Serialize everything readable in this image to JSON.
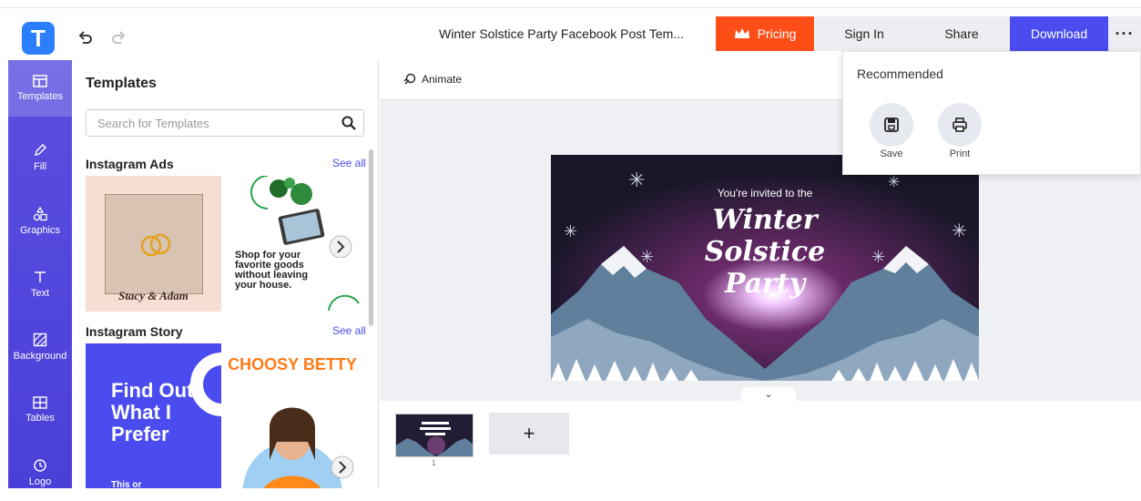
{
  "header": {
    "logo_letter": "T",
    "undo_icon": "undo-icon",
    "redo_icon": "redo-icon",
    "document_title": "Winter Solstice Party Facebook Post Tem...",
    "pricing_label": "Pricing",
    "pricing_icon": "crown-icon",
    "sign_in_label": "Sign In",
    "share_label": "Share",
    "download_label": "Download",
    "more_label": "···",
    "colors": {
      "pricing": "#ff4d17",
      "download": "#4b4cf0",
      "neutral": "#eceef1"
    }
  },
  "sidebar": {
    "items": [
      {
        "label": "Templates",
        "icon": "templates-icon",
        "active": true
      },
      {
        "label": "Fill",
        "icon": "pencil-icon"
      },
      {
        "label": "Graphics",
        "icon": "shapes-icon"
      },
      {
        "label": "Text",
        "icon": "text-icon"
      },
      {
        "label": "Background",
        "icon": "background-icon"
      },
      {
        "label": "Tables",
        "icon": "table-icon"
      },
      {
        "label": "Logo",
        "icon": "logo-icon"
      }
    ],
    "color": "#4b4cf0"
  },
  "templates_panel": {
    "title": "Templates",
    "search_placeholder": "Search for Templates",
    "sections": [
      {
        "title": "Instagram Ads",
        "see_all": "See all",
        "cards": [
          {
            "script_name": "Stacy & Adam"
          },
          {
            "headline": "Shop for your favorite goods without leaving your house."
          }
        ]
      },
      {
        "title": "Instagram Story",
        "see_all": "See all",
        "cards": [
          {
            "headline": "Find Out What I Prefer",
            "footer": "This or"
          },
          {
            "brand": "CHOOSY BETTY"
          }
        ]
      }
    ]
  },
  "toolbar": {
    "animate_label": "Animate",
    "animate_icon": "animate-icon"
  },
  "canvas": {
    "invite_text": "You're invited to the",
    "title_lines": [
      "Winter",
      "Solstice",
      "Party"
    ],
    "expand_icon": "chevron-down-icon"
  },
  "pages": {
    "thumbnail_number": "1",
    "add_label": "+"
  },
  "download_menu": {
    "title": "Recommended",
    "options": [
      {
        "label": "Save",
        "icon": "save-icon"
      },
      {
        "label": "Print",
        "icon": "print-icon"
      }
    ]
  }
}
